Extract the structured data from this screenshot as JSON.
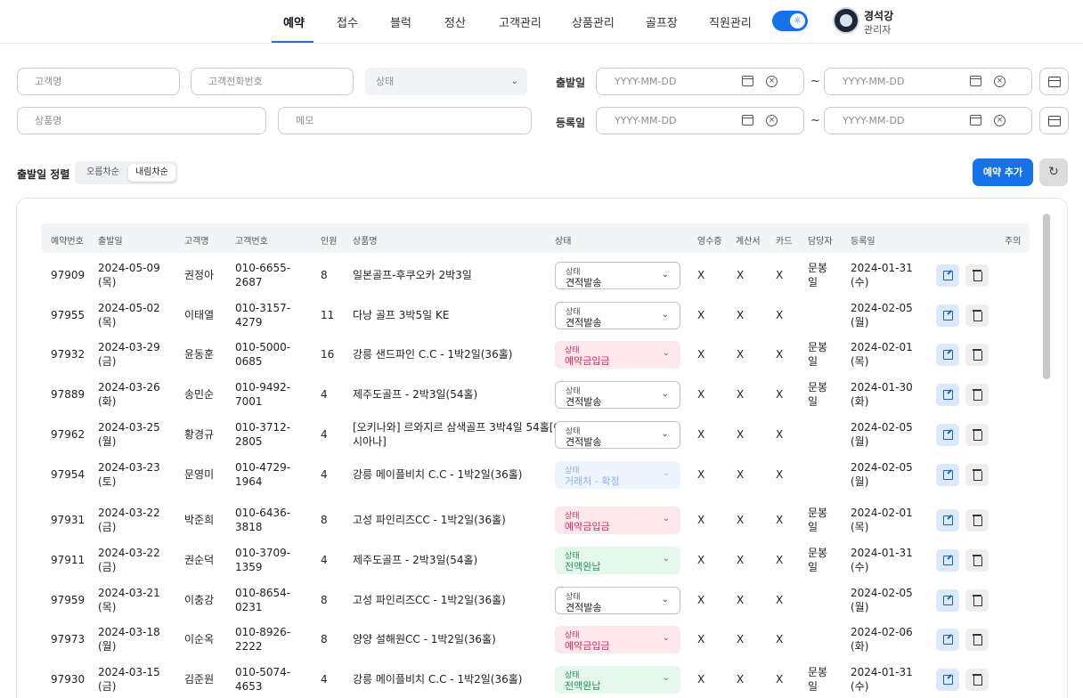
{
  "nav": {
    "items": [
      "예약",
      "접수",
      "블럭",
      "정산",
      "고객관리",
      "상품관리",
      "골프장",
      "직원관리"
    ],
    "user_name": "경석강",
    "user_role": "관리자"
  },
  "filters": {
    "customer_name": "고객명",
    "customer_phone": "고객전화번호",
    "status": "상태",
    "product_name": "상품명",
    "memo": "메모",
    "departure_label": "출발일",
    "registered_label": "등록일",
    "date_placeholder": "YYYY-MM-DD",
    "tilde": "~"
  },
  "sort": {
    "label": "출발일 정렬",
    "asc": "오름차순",
    "desc": "내림차순",
    "selected": "desc"
  },
  "actions": {
    "add": "예약 추가"
  },
  "table": {
    "headers": [
      "예약번호",
      "출발일",
      "고객명",
      "고객번호",
      "인원",
      "상품명",
      "상태",
      "영수증",
      "계산서",
      "카드",
      "담당자",
      "등록일",
      "주의"
    ],
    "status_caption": "상태",
    "rows": [
      {
        "id": "97909",
        "date": "2024-05-09",
        "day": "(목)",
        "name": "권정아",
        "phone1": "010-6655-",
        "phone2": "2687",
        "count": "8",
        "product1": "일본골프-후쿠오카 2박3일",
        "product2": "",
        "status": "견적발송",
        "tone": "plain",
        "receipt": "X",
        "invoice": "X",
        "card": "X",
        "mgr1": "문봉",
        "mgr2": "일",
        "reg": "2024-01-31",
        "reg_day": "(수)"
      },
      {
        "id": "97955",
        "date": "2024-05-02",
        "day": "(목)",
        "name": "이태열",
        "phone1": "010-3157-",
        "phone2": "4279",
        "count": "11",
        "product1": "다낭 골프 3박5일 KE",
        "product2": "",
        "status": "견적발송",
        "tone": "plain",
        "receipt": "X",
        "invoice": "X",
        "card": "X",
        "mgr1": "",
        "mgr2": "",
        "reg": "2024-02-05",
        "reg_day": "(월)"
      },
      {
        "id": "97932",
        "date": "2024-03-29",
        "day": "(금)",
        "name": "윤동훈",
        "phone1": "010-5000-",
        "phone2": "0685",
        "count": "16",
        "product1": "강릉 샌드파인 C.C - 1박2일(36홀)",
        "product2": "",
        "status": "예약금입금",
        "tone": "pink",
        "receipt": "X",
        "invoice": "X",
        "card": "X",
        "mgr1": "문봉",
        "mgr2": "일",
        "reg": "2024-02-01",
        "reg_day": "(목)"
      },
      {
        "id": "97889",
        "date": "2024-03-26",
        "day": "(화)",
        "name": "송민순",
        "phone1": "010-9492-",
        "phone2": "7001",
        "count": "4",
        "product1": "제주도골프 - 2박3일(54홀)",
        "product2": "",
        "status": "견적발송",
        "tone": "plain",
        "receipt": "X",
        "invoice": "X",
        "card": "X",
        "mgr1": "문봉",
        "mgr2": "일",
        "reg": "2024-01-30",
        "reg_day": "(화)"
      },
      {
        "id": "97962",
        "date": "2024-03-25",
        "day": "(월)",
        "name": "황경규",
        "phone1": "010-3712-",
        "phone2": "2805",
        "count": "4",
        "product1": "[오키나와] 르와지르 삼색골프 3박4일 54홀[아",
        "product2": "시아나]",
        "status": "견적발송",
        "tone": "plain",
        "receipt": "X",
        "invoice": "X",
        "card": "X",
        "mgr1": "",
        "mgr2": "",
        "reg": "2024-02-05",
        "reg_day": "(월)"
      },
      {
        "id": "97954",
        "date": "2024-03-23",
        "day": "(토)",
        "name": "문영미",
        "phone1": "010-4729-",
        "phone2": "1964",
        "count": "4",
        "product1": "강릉 메이플비치 C.C - 1박2일(36홀)",
        "product2": "",
        "status": "거래처 - 확정",
        "tone": "blue",
        "receipt": "X",
        "invoice": "X",
        "card": "X",
        "mgr1": "",
        "mgr2": "",
        "reg": "2024-02-05",
        "reg_day": "(월)"
      },
      {
        "id": "97931",
        "date": "2024-03-22",
        "day": "(금)",
        "name": "박준희",
        "phone1": "010-6436-",
        "phone2": "3818",
        "count": "8",
        "product1": "고성 파인리즈CC - 1박2일(36홀)",
        "product2": "",
        "status": "예약금입금",
        "tone": "pink",
        "receipt": "X",
        "invoice": "X",
        "card": "X",
        "mgr1": "문봉",
        "mgr2": "일",
        "reg": "2024-02-01",
        "reg_day": "(목)"
      },
      {
        "id": "97911",
        "date": "2024-03-22",
        "day": "(금)",
        "name": "권순덕",
        "phone1": "010-3709-",
        "phone2": "1359",
        "count": "4",
        "product1": "제주도골프 - 2박3일(54홀)",
        "product2": "",
        "status": "전액완납",
        "tone": "green",
        "receipt": "X",
        "invoice": "X",
        "card": "X",
        "mgr1": "문봉",
        "mgr2": "일",
        "reg": "2024-01-31",
        "reg_day": "(수)"
      },
      {
        "id": "97959",
        "date": "2024-03-21",
        "day": "(목)",
        "name": "이충강",
        "phone1": "010-8654-",
        "phone2": "0231",
        "count": "8",
        "product1": "고성 파인리즈CC - 1박2일(36홀)",
        "product2": "",
        "status": "견적발송",
        "tone": "plain",
        "receipt": "X",
        "invoice": "X",
        "card": "X",
        "mgr1": "",
        "mgr2": "",
        "reg": "2024-02-05",
        "reg_day": "(월)"
      },
      {
        "id": "97973",
        "date": "2024-03-18",
        "day": "(월)",
        "name": "이순옥",
        "phone1": "010-8926-",
        "phone2": "2222",
        "count": "8",
        "product1": "양양 설해원CC - 1박2일(36홀)",
        "product2": "",
        "status": "예약금입금",
        "tone": "pink",
        "receipt": "X",
        "invoice": "X",
        "card": "X",
        "mgr1": "",
        "mgr2": "",
        "reg": "2024-02-06",
        "reg_day": "(화)"
      },
      {
        "id": "97930",
        "date": "2024-03-15",
        "day": "(금)",
        "name": "김준원",
        "phone1": "010-5074-",
        "phone2": "4653",
        "count": "4",
        "product1": "강릉 메이플비치 C.C - 1박2일(36홀)",
        "product2": "",
        "status": "전액완납",
        "tone": "green",
        "receipt": "X",
        "invoice": "X",
        "card": "X",
        "mgr1": "문봉",
        "mgr2": "일",
        "reg": "2024-01-31",
        "reg_day": "(수)"
      }
    ]
  },
  "colors": {
    "accent": "#1572e8",
    "pink_status": "#d4305d",
    "green_status": "#23915a"
  }
}
